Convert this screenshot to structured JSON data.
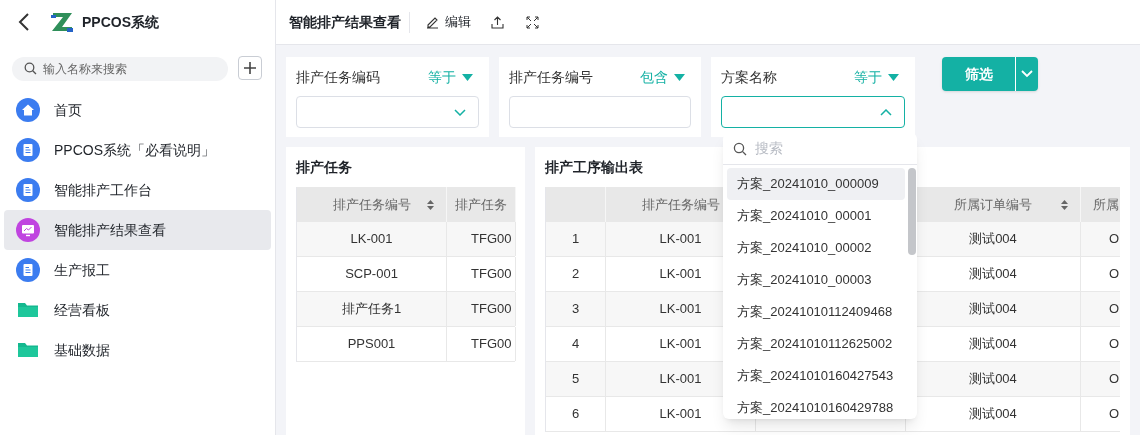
{
  "sidebar": {
    "app_title": "PPCOS系统",
    "search": {
      "placeholder": "输入名称来搜索"
    },
    "items": [
      {
        "label": "首页",
        "kind": "home",
        "selected": false
      },
      {
        "label": "PPCOS系统「必看说明」",
        "kind": "doc",
        "selected": false
      },
      {
        "label": "智能排产工作台",
        "kind": "doc",
        "selected": false
      },
      {
        "label": "智能排产结果查看",
        "kind": "screen",
        "selected": true
      },
      {
        "label": "生产报工",
        "kind": "doc",
        "selected": false
      },
      {
        "label": "经营看板",
        "kind": "folder",
        "selected": false
      },
      {
        "label": "基础数据",
        "kind": "folder",
        "selected": false
      }
    ]
  },
  "topbar": {
    "title": "智能排产结果查看",
    "edit_label": "编辑"
  },
  "filters": [
    {
      "label": "排产任务编码",
      "operator": "等于",
      "kind": "select",
      "open": false
    },
    {
      "label": "排产任务编号",
      "operator": "包含",
      "kind": "text",
      "open": false
    },
    {
      "label": "方案名称",
      "operator": "等于",
      "kind": "select",
      "open": true
    }
  ],
  "filter_button": "筛选",
  "left_panel": {
    "title": "排产任务",
    "columns": [
      {
        "label": "排产任务编号",
        "sortable": true
      },
      {
        "label": "排产任务",
        "sortable": false
      }
    ],
    "rows": [
      [
        "LK-001",
        "TFG00"
      ],
      [
        "SCP-001",
        "TFG00"
      ],
      [
        "排产任务1",
        "TFG00"
      ],
      [
        "PPS001",
        "TFG00"
      ]
    ]
  },
  "right_panel": {
    "title": "排产工序输出表",
    "columns": [
      {
        "sortable": false
      },
      {
        "label": "排产任务编号"
      },
      {},
      {
        "label": "所属订单编号",
        "sortable": true
      },
      {
        "label": "所属",
        "sortable": false
      }
    ],
    "rows": [
      [
        "1",
        "LK-001",
        "",
        "测试004",
        "O"
      ],
      [
        "2",
        "LK-001",
        "",
        "测试004",
        "O"
      ],
      [
        "3",
        "LK-001",
        "",
        "测试004",
        "O"
      ],
      [
        "4",
        "LK-001",
        "",
        "测试004",
        "O"
      ],
      [
        "5",
        "LK-001",
        "",
        "测试004",
        "O"
      ],
      [
        "6",
        "LK-001",
        "",
        "测试004",
        "O"
      ]
    ]
  },
  "dropdown": {
    "placeholder": "搜索",
    "options": [
      {
        "label": "方案_20241010_000009",
        "selected": true
      },
      {
        "label": "方案_20241010_00001",
        "selected": false
      },
      {
        "label": "方案_20241010_00002",
        "selected": false
      },
      {
        "label": "方案_20241010_00003",
        "selected": false
      },
      {
        "label": "方案_20241010112409468",
        "selected": false
      },
      {
        "label": "方案_20241010112625002",
        "selected": false
      },
      {
        "label": "方案_20241010160427543",
        "selected": false
      },
      {
        "label": "方案_20241010160429788",
        "selected": false
      }
    ]
  }
}
